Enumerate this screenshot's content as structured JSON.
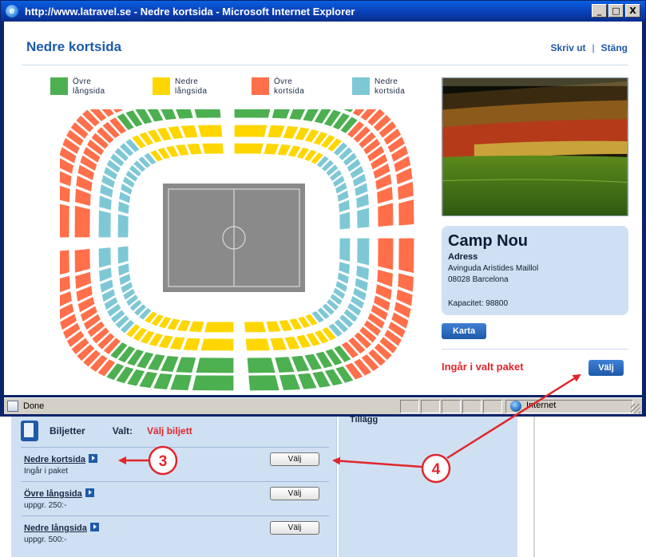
{
  "window": {
    "title": "http://www.latravel.se - Nedre kortsida - Microsoft Internet Explorer",
    "controls": {
      "minimize": "_",
      "maximize": "□",
      "close": "X"
    }
  },
  "popup": {
    "title": "Nedre kortsida",
    "links": {
      "print": "Skriv ut",
      "separator": "|",
      "close": "Stäng"
    },
    "legend": [
      {
        "label": "Övre\nlångsida",
        "color": "#4caf50"
      },
      {
        "label": "Nedre\nlångsida",
        "color": "#ffd600"
      },
      {
        "label": "Övre\nkortsida",
        "color": "#ff6f4a"
      },
      {
        "label": "Nedre\nkortsida",
        "color": "#7ec8d6"
      }
    ],
    "stadium": {
      "name": "Camp Nou",
      "address_label": "Adress",
      "address_line1": "Avinguda Aristides Maillol",
      "address_line2": "08028 Barcelona",
      "capacity": "Kapacitet: 98800"
    },
    "map_button": "Karta",
    "included_text": "Ingår i valt paket",
    "select_button": "Välj",
    "photo_icon": "stadium-photo"
  },
  "statusbar": {
    "text": "Done",
    "zone": "Internet"
  },
  "page": {
    "header": {
      "section": "Biljetter",
      "selected_label": "Valt:",
      "selected_value": "Välj biljett",
      "extras": "Tillägg"
    },
    "tickets": [
      {
        "name": "Nedre kortsida",
        "sub": "Ingår i paket",
        "button": "Välj"
      },
      {
        "name": "Övre långsida",
        "sub": "uppgr. 250:-",
        "button": "Välj"
      },
      {
        "name": "Nedre långsida",
        "sub": "uppgr. 500:-",
        "button": "Välj"
      }
    ]
  },
  "annotations": {
    "callout_3": "3",
    "callout_4": "4",
    "color": "#e0262b"
  }
}
